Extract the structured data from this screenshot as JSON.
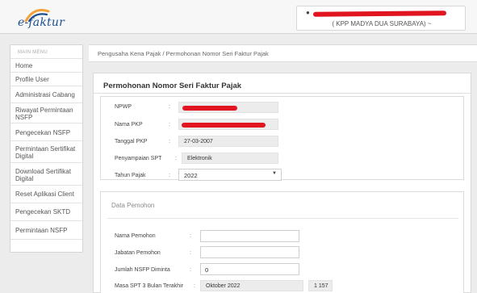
{
  "header": {
    "logo_text": "e-faktur",
    "user_office": "( KPP MADYA DUA SURABAYA) ~"
  },
  "sidebar": {
    "title": "MAIN MENU",
    "items": [
      {
        "lines": [
          "Home"
        ]
      },
      {
        "lines": [
          "Profile User"
        ]
      },
      {
        "lines": [
          "Administrasi Cabang"
        ]
      },
      {
        "lines": [
          "Riwayat Permintaan",
          "NSFP"
        ]
      },
      {
        "lines": [
          "Pengecekan NSFP"
        ]
      },
      {
        "lines": [
          "Permintaan Sertifikat",
          "Digital"
        ]
      },
      {
        "lines": [
          "Download Sertifikat",
          "Digital"
        ]
      },
      {
        "lines": [
          "Reset Aplikasi Client"
        ]
      },
      {
        "lines": [
          "Pengecekan SKTD"
        ]
      },
      {
        "lines": [
          "Permintaan NSFP"
        ]
      }
    ]
  },
  "breadcrumb": "Pengusaha Kena Pajak /  Permohonan Nomor Seri Faktur Pajak",
  "panel": {
    "title": "Permohonan Nomor Seri Faktur Pajak",
    "colon": ":",
    "fields": {
      "npwp_label": "NPWP",
      "nama_pkp_label": "Nama PKP",
      "tanggal_pkp_label": "Tanggal PKP",
      "tanggal_pkp_value": "27-03-2007",
      "spt_label": "Penyampaian SPT",
      "spt_value": "Elektronik",
      "tahun_pajak_label": "Tahun Pajak",
      "tahun_pajak_value": "2022"
    },
    "pemohon": {
      "section_title": "Data Pemohon",
      "nama_label": "Nama Pemohon",
      "nama_value": "",
      "jabatan_label": "Jabatan Pemohon",
      "jabatan_value": "",
      "jumlah_label": "Jumlah NSFP Diminta",
      "jumlah_value": "0",
      "masa_label": "Masa SPT 3 Bulan Terakhir",
      "masa_value": "Oktober 2022",
      "masa_amount": "1 157"
    }
  },
  "colors": {
    "redaction": "#e0151f",
    "brand_blue": "#1d4f8f",
    "accent_orange": "#f2a23a"
  }
}
